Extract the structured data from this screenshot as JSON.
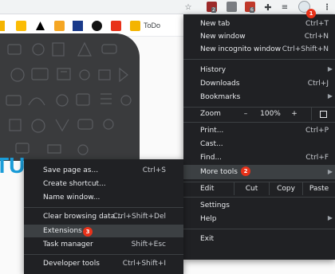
{
  "colors": {
    "menu_bg": "#202124",
    "highlight": "#3c4043",
    "step_marker": "#e8321a",
    "hero_text": "#1a9cd8"
  },
  "toolbar": {
    "icons": [
      "star-icon",
      "extension-badge-icon",
      "extension-icon",
      "extension-icon",
      "puzzle-icon",
      "media-queue-icon",
      "profile-avatar",
      "more-vert-icon"
    ],
    "badges": [
      "2",
      "6"
    ]
  },
  "bookmarks": {
    "todo_label": "ToDo"
  },
  "hero": {
    "text": "TU"
  },
  "menu": {
    "items": [
      {
        "label": "New tab",
        "shortcut": "Ctrl+T"
      },
      {
        "label": "New window",
        "shortcut": "Ctrl+N"
      },
      {
        "label": "New incognito window",
        "shortcut": "Ctrl+Shift+N"
      },
      {
        "label": "History",
        "shortcut": ""
      },
      {
        "label": "Downloads",
        "shortcut": "Ctrl+J"
      },
      {
        "label": "Bookmarks",
        "shortcut": ""
      },
      {
        "label": "Print...",
        "shortcut": "Ctrl+P"
      },
      {
        "label": "Cast...",
        "shortcut": ""
      },
      {
        "label": "Find...",
        "shortcut": "Ctrl+F"
      },
      {
        "label": "More tools",
        "shortcut": ""
      },
      {
        "label": "Settings",
        "shortcut": ""
      },
      {
        "label": "Help",
        "shortcut": ""
      },
      {
        "label": "Exit",
        "shortcut": ""
      }
    ],
    "zoom": {
      "label": "Zoom",
      "minus": "–",
      "value": "100%",
      "plus": "+"
    },
    "edit": {
      "label": "Edit",
      "cut": "Cut",
      "copy": "Copy",
      "paste": "Paste"
    }
  },
  "submenu": {
    "items": [
      {
        "label": "Save page as...",
        "shortcut": "Ctrl+S"
      },
      {
        "label": "Create shortcut...",
        "shortcut": ""
      },
      {
        "label": "Name window...",
        "shortcut": ""
      },
      {
        "label": "Clear browsing data...",
        "shortcut": "Ctrl+Shift+Del"
      },
      {
        "label": "Extensions",
        "shortcut": ""
      },
      {
        "label": "Task manager",
        "shortcut": "Shift+Esc"
      },
      {
        "label": "Developer tools",
        "shortcut": "Ctrl+Shift+I"
      }
    ]
  },
  "steps": [
    "1",
    "2",
    "3"
  ]
}
